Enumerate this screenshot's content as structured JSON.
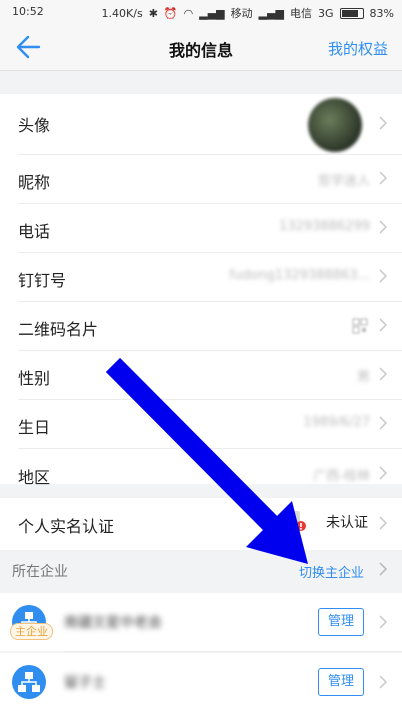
{
  "status_bar": {
    "time": "10:52",
    "network_speed": "1.40K/s",
    "carrier1": "移动",
    "carrier2": "电信",
    "network_type": "3G",
    "battery": "83%",
    "battery_level": 0.83
  },
  "nav": {
    "title": "我的信息",
    "right_link": "我的权益"
  },
  "profile": {
    "rows": [
      {
        "label": "头像",
        "value": ""
      },
      {
        "label": "昵称",
        "value": "哲学迷人"
      },
      {
        "label": "电话",
        "value": "13293886299"
      },
      {
        "label": "钉钉号",
        "value": "fudong1329388863..."
      },
      {
        "label": "二维码名片",
        "value": ""
      },
      {
        "label": "性别",
        "value": "男"
      },
      {
        "label": "生日",
        "value": "1989/6/27"
      },
      {
        "label": "地区",
        "value": "广西-桂林"
      }
    ]
  },
  "certification": {
    "label": "个人实名认证",
    "status": "未认证"
  },
  "company_section": {
    "label": "所在企业",
    "switch_link": "切换主企业",
    "main_badge": "主企业",
    "manage_label": "管理",
    "companies": [
      {
        "name": "南疆文星中老会"
      },
      {
        "name": "留子士"
      }
    ]
  },
  "colors": {
    "accent": "#2f8ef0",
    "annotation_arrow": "#0000ee"
  }
}
